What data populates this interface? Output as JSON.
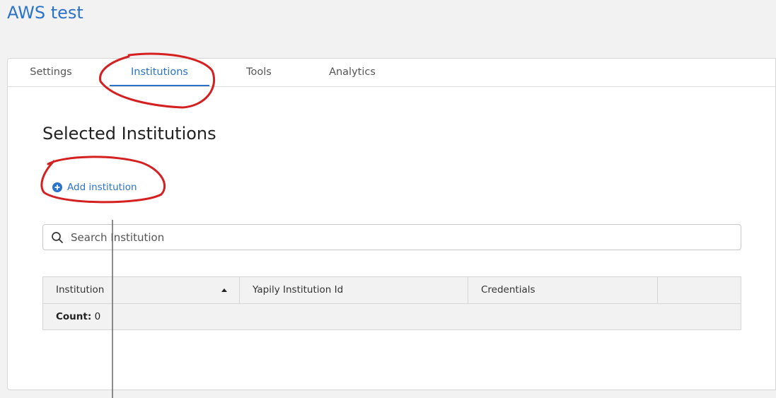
{
  "app": {
    "title": "AWS test"
  },
  "tabs": [
    {
      "label": "Settings",
      "active": false
    },
    {
      "label": "Institutions",
      "active": true
    },
    {
      "label": "Tools",
      "active": false
    },
    {
      "label": "Analytics",
      "active": false
    }
  ],
  "section": {
    "title": "Selected Institutions",
    "add_label": "Add institution",
    "add_icon": "plus-circle-icon"
  },
  "search": {
    "placeholder": "Search Institution",
    "value": "",
    "icon": "search-icon"
  },
  "table": {
    "columns": [
      "Institution",
      "Yapily Institution Id",
      "Credentials",
      ""
    ],
    "sort": {
      "column": "Institution",
      "direction": "ascending"
    },
    "count_label": "Count:",
    "count_value": "0"
  },
  "colors": {
    "accent": "#2a73c9",
    "annotation": "#d42020",
    "background": "#f2f2f2"
  }
}
